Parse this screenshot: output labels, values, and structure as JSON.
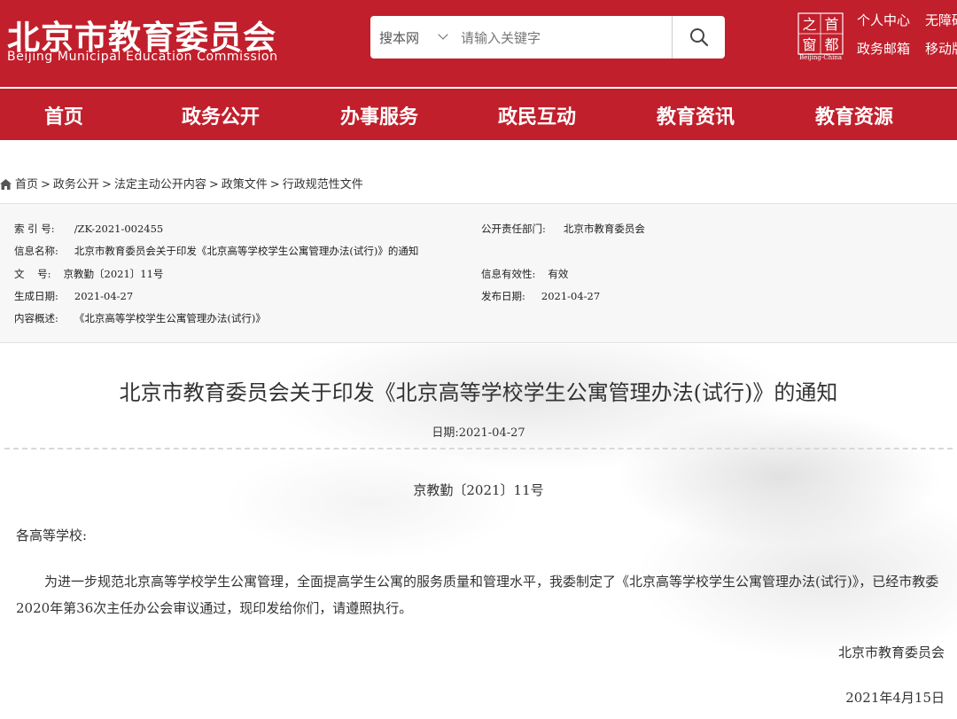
{
  "header": {
    "logo_cn": "北京市教育委员会",
    "logo_en": "Beijing Municipal Education Commission",
    "search": {
      "scope": "搜本网",
      "placeholder": "请输入关键字"
    },
    "emblem": {
      "chars": [
        "之",
        "首",
        "窗",
        "都"
      ],
      "caption": "Beijing-China"
    },
    "links": {
      "personal_center": "个人中心",
      "accessibility": "无障碍",
      "gov_mailbox": "政务邮箱",
      "mobile": "移动版"
    }
  },
  "nav": {
    "items": [
      "首页",
      "政务公开",
      "办事服务",
      "政民互动",
      "教育资讯",
      "教育资源"
    ]
  },
  "breadcrumb": {
    "items": [
      "首页",
      "政务公开",
      "法定主动公开内容",
      "政策文件",
      "行政规范性文件"
    ],
    "separator": ">"
  },
  "info": {
    "index_label": "索 引 号:",
    "index_value": "/ZK-2021-002455",
    "dept_label": "公开责任部门:",
    "dept_value": "北京市教育委员会",
    "name_label": "信息名称:",
    "name_value": "北京市教育委员会关于印发《北京高等学校学生公寓管理办法(试行)》的通知",
    "docno_label": "文    号:",
    "docno_value": "京教勤〔2021〕11号",
    "validity_label": "信息有效性:",
    "validity_value": "有效",
    "created_label": "生成日期:",
    "created_value": "2021-04-27",
    "published_label": "发布日期:",
    "published_value": "2021-04-27",
    "summary_label": "内容概述:",
    "summary_value": "《北京高等学校学生公寓管理办法(试行)》"
  },
  "article": {
    "title": "北京市教育委员会关于印发《北京高等学校学生公寓管理办法(试行)》的通知",
    "date_line": "日期:2021-04-27",
    "doc_number": "京教勤〔2021〕11号",
    "addressee": "各高等学校:",
    "paragraph": "为进一步规范北京高等学校学生公寓管理，全面提高学生公寓的服务质量和管理水平，我委制定了《北京高等学校学生公寓管理办法(试行)》，已经市教委2020年第36次主任办公会审议通过，现印发给你们，请遵照执行。",
    "signature": "北京市教育委员会",
    "sign_date": "2021年4月15日"
  },
  "colors": {
    "brand_red": "#c11f2c",
    "info_bg": "#f7f7f7"
  }
}
